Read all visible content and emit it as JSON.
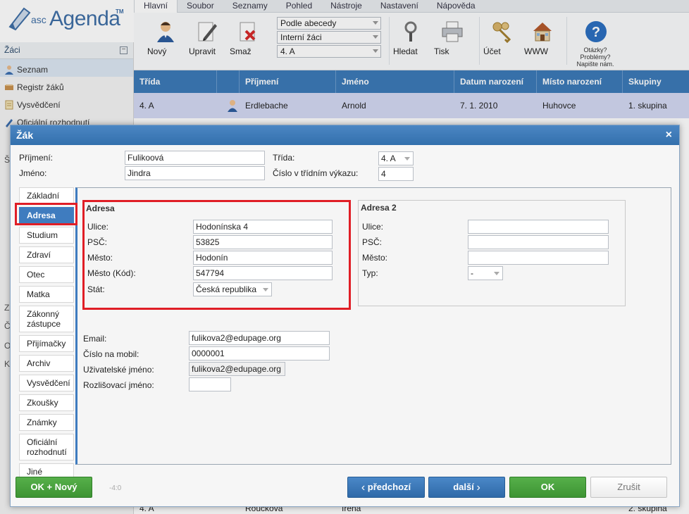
{
  "app": {
    "logo_asc": "asc",
    "logo_name": "Agenda",
    "logo_tm": "TM",
    "accent": "#3c7ab8"
  },
  "ribbon_tabs": [
    "Hlavní",
    "Soubor",
    "Seznamy",
    "Pohled",
    "Nástroje",
    "Nastavení",
    "Nápověda"
  ],
  "ribbon": {
    "new_label": "Nový",
    "edit_label": "Upravit",
    "delete_label": "Smaž",
    "sort_select": "Podle abecedy",
    "students_select": "Interní žáci",
    "class_select": "4. A",
    "search_label": "Hledat",
    "print_label": "Tisk",
    "account_label": "Účet",
    "www_label": "WWW",
    "help_line1": "Otázky?",
    "help_line2": "Problémy?",
    "help_line3": "Napište nám."
  },
  "sidebar": {
    "header": "Žáci",
    "collapse": "−",
    "items": [
      {
        "label": "Seznam",
        "icon": "person-icon"
      },
      {
        "label": "Registr žáků",
        "icon": "book-icon"
      },
      {
        "label": "Vysvědčení",
        "icon": "certificate-icon"
      },
      {
        "label": "Oficiální rozhodnutí",
        "icon": "pen-icon"
      }
    ],
    "fragments": [
      "Š",
      "Z",
      "Č",
      "O",
      "K"
    ]
  },
  "table": {
    "headers": [
      "Třída",
      "",
      "Příjmení",
      "Jméno",
      "Datum narození",
      "Místo narození",
      "Skupiny"
    ],
    "selected_row": [
      "4. A",
      "",
      "Erdlebache",
      "Arnold",
      "7. 1. 2010",
      "Huhovce",
      "1. skupina"
    ],
    "bottom_row": [
      "4. A",
      "",
      "Roučková",
      "Irena",
      "",
      "",
      "2. skupina"
    ]
  },
  "dialog": {
    "title": "Žák",
    "close": "×",
    "surname_label": "Příjmení:",
    "surname_value": "Fulikoová",
    "name_label": "Jméno:",
    "name_value": "Jindra",
    "class_label": "Třída:",
    "class_value": "4. A",
    "classno_label": "Číslo v třídním výkazu:",
    "classno_value": "4",
    "tabs": [
      "Základní",
      "Adresa",
      "Studium",
      "Zdraví",
      "Otec",
      "Matka",
      "Zákonný zástupce",
      "Přijímačky",
      "Archiv",
      "Vysvědčení",
      "Zkoušky",
      "Známky",
      "Oficiální rozhodnutí",
      "Jiné"
    ],
    "active_tab": "Adresa",
    "address1": {
      "title": "Adresa",
      "street_label": "Ulice:",
      "street_value": "Hodonínska 4",
      "zip_label": "PSČ:",
      "zip_value": "53825",
      "city_label": "Město:",
      "city_value": "Hodonín",
      "citycode_label": "Město (Kód):",
      "citycode_value": "547794",
      "country_label": "Stát:",
      "country_value": "Česká republika"
    },
    "address2": {
      "title": "Adresa 2",
      "street_label": "Ulice:",
      "street_value": "",
      "zip_label": "PSČ:",
      "zip_value": "",
      "city_label": "Město:",
      "city_value": "",
      "type_label": "Typ:",
      "type_value": "-"
    },
    "email_label": "Email:",
    "email_value": "fulikova2@edupage.org",
    "mobile_label": "Číslo na mobil:",
    "mobile_value": "0000001",
    "username_label": "Uživatelské jméno:",
    "username_value": "fulikova2@edupage.org",
    "distinguish_label": "Rozlišovací jméno:",
    "distinguish_value": "",
    "small_number": "-4:0",
    "btn_ok_new": "OK + Nový",
    "btn_prev": "předchozí",
    "btn_next": "další",
    "btn_ok": "OK",
    "btn_cancel": "Zrušit"
  }
}
